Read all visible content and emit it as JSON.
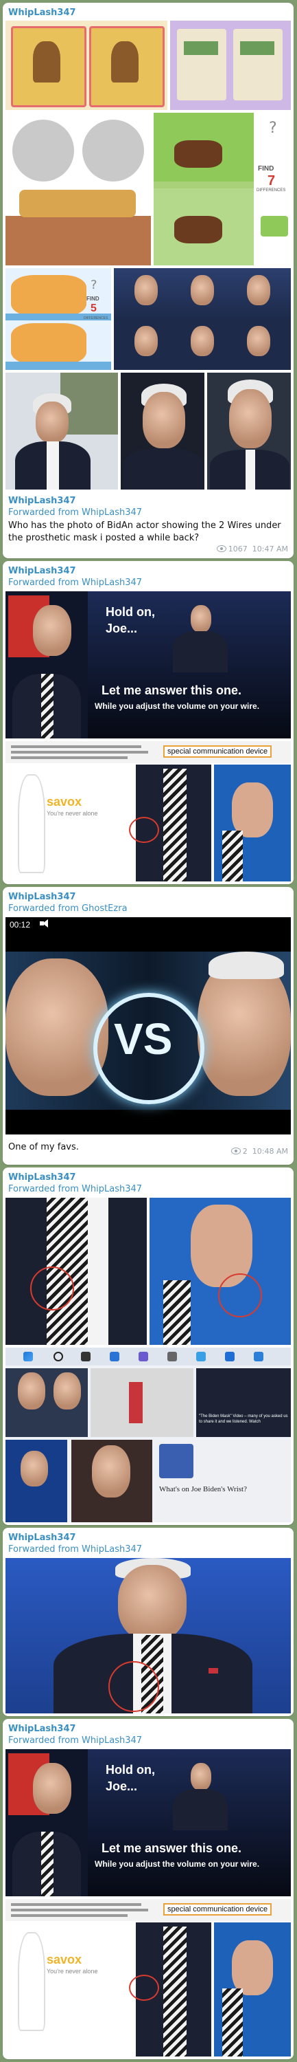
{
  "posts": [
    {
      "author": "WhipLash347"
    },
    {
      "author": "WhipLash347",
      "forwarded": "Forwarded from WhipLash347",
      "caption": "Who has the photo of BidAn actor showing the 2 Wires under the prosthetic mask i posted a while back?",
      "views": "1067",
      "time": "10:47 AM"
    },
    {
      "author": "WhipLash347",
      "forwarded": "Forwarded from WhipLash347",
      "meme_text": {
        "hold": "Hold on,",
        "joe": "Joe...",
        "answer": "Let me answer this one.",
        "volume": "While you adjust the volume on your wire."
      },
      "savox_brand": "savox",
      "savox_tag": "You're never alone",
      "special_label": "special communication device"
    },
    {
      "author": "WhipLash347",
      "forwarded": "Forwarded from GhostEzra",
      "video_time": "00:12",
      "vs_text": "VS",
      "caption": "One of my favs.",
      "views": "2",
      "time": "10:48 AM"
    },
    {
      "author": "WhipLash347",
      "forwarded": "Forwarded from WhipLash347",
      "thumb_caption_1": "\"The Biden Mask\" Video – many of you asked us to share it and we listened. Watch",
      "thumb_caption_2": "What's on Joe Biden's Wrist?"
    },
    {
      "author": "WhipLash347",
      "forwarded": "Forwarded from WhipLash347"
    },
    {
      "author": "WhipLash347",
      "forwarded": "Forwarded from WhipLash347",
      "meme_text": {
        "hold": "Hold on,",
        "joe": "Joe...",
        "answer": "Let me answer this one.",
        "volume": "While you adjust the volume on your wire."
      },
      "savox_brand": "savox",
      "savox_tag": "You're never alone",
      "special_label": "special communication device"
    }
  ],
  "puzzles": {
    "find": "FIND",
    "seven": "7",
    "five": "5",
    "differences": "DIFFERENCES"
  },
  "colors": {
    "link": "#3a8fc3",
    "background": "#7f9a6e",
    "ring": "#d83b2e",
    "meta": "#9aa3ab"
  }
}
